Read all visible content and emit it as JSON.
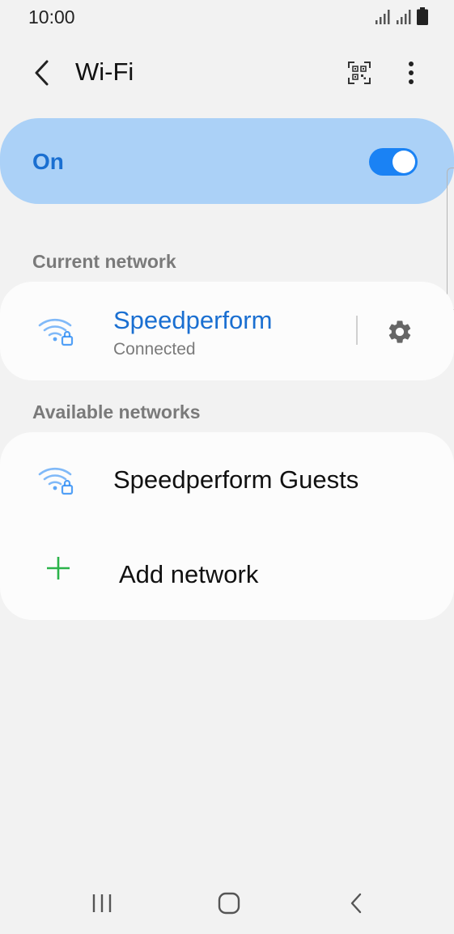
{
  "status_bar": {
    "time": "10:00",
    "icons": [
      "signal-icon",
      "signal-icon",
      "battery-icon"
    ]
  },
  "app_bar": {
    "title": "Wi-Fi",
    "icons": [
      "back-icon",
      "qr-code-icon",
      "more-options-icon"
    ]
  },
  "wifi_toggle": {
    "label": "On",
    "enabled": true,
    "accent_color": "#1a82f4",
    "card_color": "#abd1f7"
  },
  "current_network": {
    "header": "Current network",
    "name": "Speedperform",
    "status": "Connected",
    "name_color": "#1a6fd1",
    "icons": [
      "wifi-locked-icon",
      "gear-icon"
    ]
  },
  "available_networks": {
    "header": "Available networks",
    "items": [
      {
        "name": "Speedperform Guests",
        "icon": "wifi-locked-icon"
      }
    ],
    "add_network_label": "Add network",
    "add_icon_color": "#2bb34a"
  },
  "nav_bar": {
    "icons": [
      "recents-icon",
      "home-icon",
      "back-nav-icon"
    ]
  }
}
